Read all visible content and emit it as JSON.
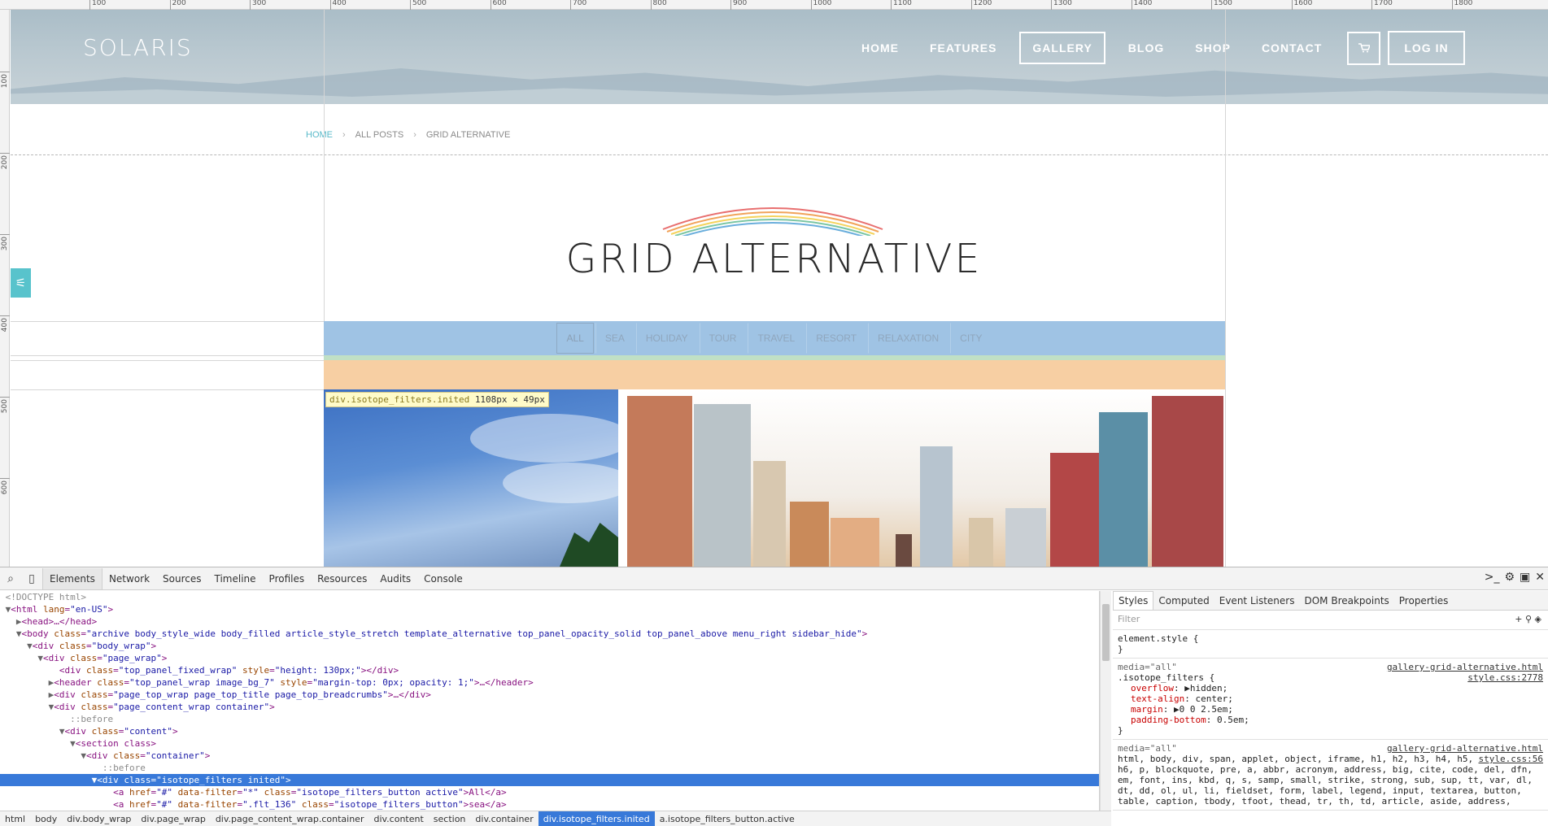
{
  "site": {
    "logo": "SOLARIS",
    "nav": [
      "HOME",
      "FEATURES",
      "GALLERY",
      "BLOG",
      "SHOP",
      "CONTACT"
    ],
    "active_nav": "GALLERY",
    "login": "LOG IN",
    "breadcrumbs": [
      "HOME",
      "ALL POSTS",
      "GRID ALTERNATIVE"
    ],
    "page_title": "GRID ALTERNATIVE",
    "filters": [
      "ALL",
      "SEA",
      "HOLIDAY",
      "TOUR",
      "TRAVEL",
      "RESORT",
      "RELAXATION",
      "CITY"
    ],
    "active_filter": "ALL"
  },
  "ruler": {
    "top": [
      "100",
      "200",
      "300",
      "400",
      "500",
      "600",
      "700",
      "800",
      "900",
      "1000",
      "1100",
      "1200",
      "1300",
      "1400",
      "1500",
      "1600",
      "1700",
      "1800"
    ],
    "left": [
      "100",
      "200",
      "300",
      "400",
      "500",
      "600"
    ]
  },
  "tooltip": {
    "selector": "div.isotope_filters.inited",
    "size": "1108px × 49px"
  },
  "devtools": {
    "tabs": [
      "Elements",
      "Network",
      "Sources",
      "Timeline",
      "Profiles",
      "Resources",
      "Audits",
      "Console"
    ],
    "active_tab": "Elements",
    "dom_lines": [
      "<!DOCTYPE html>",
      "▼<html lang=\"en-US\">",
      "  ▶<head>…</head>",
      "  ▼<body class=\"archive body_style_wide body_filled article_style_stretch template_alternative top_panel_opacity_solid top_panel_above menu_right sidebar_hide\">",
      "    ▼<div class=\"body_wrap\">",
      "      ▼<div class=\"page_wrap\">",
      "          <div class=\"top_panel_fixed_wrap\" style=\"height: 130px;\"></div>",
      "        ▶<header class=\"top_panel_wrap image_bg_7\" style=\"margin-top: 0px; opacity: 1;\">…</header>",
      "        ▶<div class=\"page_top_wrap page_top_title page_top_breadcrumbs\">…</div>",
      "        ▼<div class=\"page_content_wrap container\">",
      "            ::before",
      "          ▼<div class=\"content\">",
      "            ▼<section class>",
      "              ▼<div class=\"container\">",
      "                  ::before",
      "                ▼<div class=\"isotope_filters inited\">",
      "                    <a href=\"#\" data-filter=\"*\" class=\"isotope_filters_button active\">All</a>",
      "                    <a href=\"#\" data-filter=\".flt_136\" class=\"isotope_filters_button\">sea</a>"
    ],
    "selected_line": 15,
    "crumbs": [
      "html",
      "body",
      "div.body_wrap",
      "div.page_wrap",
      "div.page_content_wrap.container",
      "div.content",
      "section",
      "div.container",
      "div.isotope_filters.inited",
      "a.isotope_filters_button.active"
    ],
    "active_crumb": "div.isotope_filters.inited",
    "styles_tabs": [
      "Styles",
      "Computed",
      "Event Listeners",
      "DOM Breakpoints",
      "Properties"
    ],
    "filter_placeholder": "Filter",
    "element_style": "element.style {",
    "rule1": {
      "media": "media=\"all\"",
      "selector": ".isotope_filters {",
      "source": "gallery-grid-alternative.html",
      "source_line": "style.css:2778",
      "props": [
        [
          "overflow",
          "▶hidden;"
        ],
        [
          "text-align",
          "center;"
        ],
        [
          "margin",
          "▶0 0 2.5em;"
        ],
        [
          "padding-bottom",
          "0.5em;"
        ]
      ]
    },
    "rule2": {
      "media": "media=\"all\"",
      "source": "gallery-grid-alternative.html",
      "source_line": "style.css:56",
      "selector_lines": [
        "html, body, div, span, applet, object, iframe, h1, h2, h3, h4, h5,",
        "h6, p, blockquote, pre, a, abbr, acronym, address, big, cite, code, del, dfn,",
        "em, font, ins, kbd, q, s, samp, small, strike, strong, sub, sup, tt, var, dl,",
        "dt, dd, ol, ul, li, fieldset, form, label, legend, input, textarea, button,",
        "table, caption, tbody, tfoot, thead, tr, th, td, article, aside, address,"
      ]
    }
  },
  "colors": {
    "accent": "#58b9c9",
    "filter_bg": "#9fc3e4",
    "margin_overlay": "#f7cfa3",
    "selection": "#3879d9"
  }
}
